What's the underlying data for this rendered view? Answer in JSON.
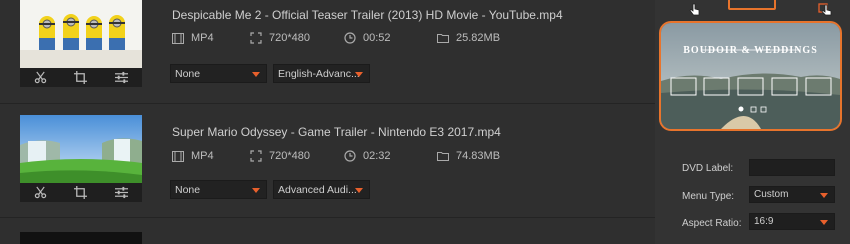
{
  "videos": [
    {
      "title": "Despicable Me 2 - Official Teaser Trailer (2013) HD Movie - YouTube.mp4",
      "format": "MP4",
      "resolution": "720*480",
      "duration": "00:52",
      "size": "25.82MB",
      "subtitle": "None",
      "audio": "English-Advanc..."
    },
    {
      "title": "Super Mario Odyssey - Game Trailer - Nintendo E3 2017.mp4",
      "format": "MP4",
      "resolution": "720*480",
      "duration": "02:32",
      "size": "74.83MB",
      "subtitle": "None",
      "audio": "Advanced Audi..."
    }
  ],
  "template_preview": {
    "title": "BOUDOIR & WEDDINGS"
  },
  "settings": {
    "dvd_label": {
      "label": "DVD Label:",
      "value": ""
    },
    "menu_type": {
      "label": "Menu Type:",
      "value": "Custom"
    },
    "aspect_ratio": {
      "label": "Aspect Ratio:",
      "value": "16:9"
    }
  },
  "colors": {
    "accent": "#e8742c",
    "arrow": "#e8602c"
  }
}
